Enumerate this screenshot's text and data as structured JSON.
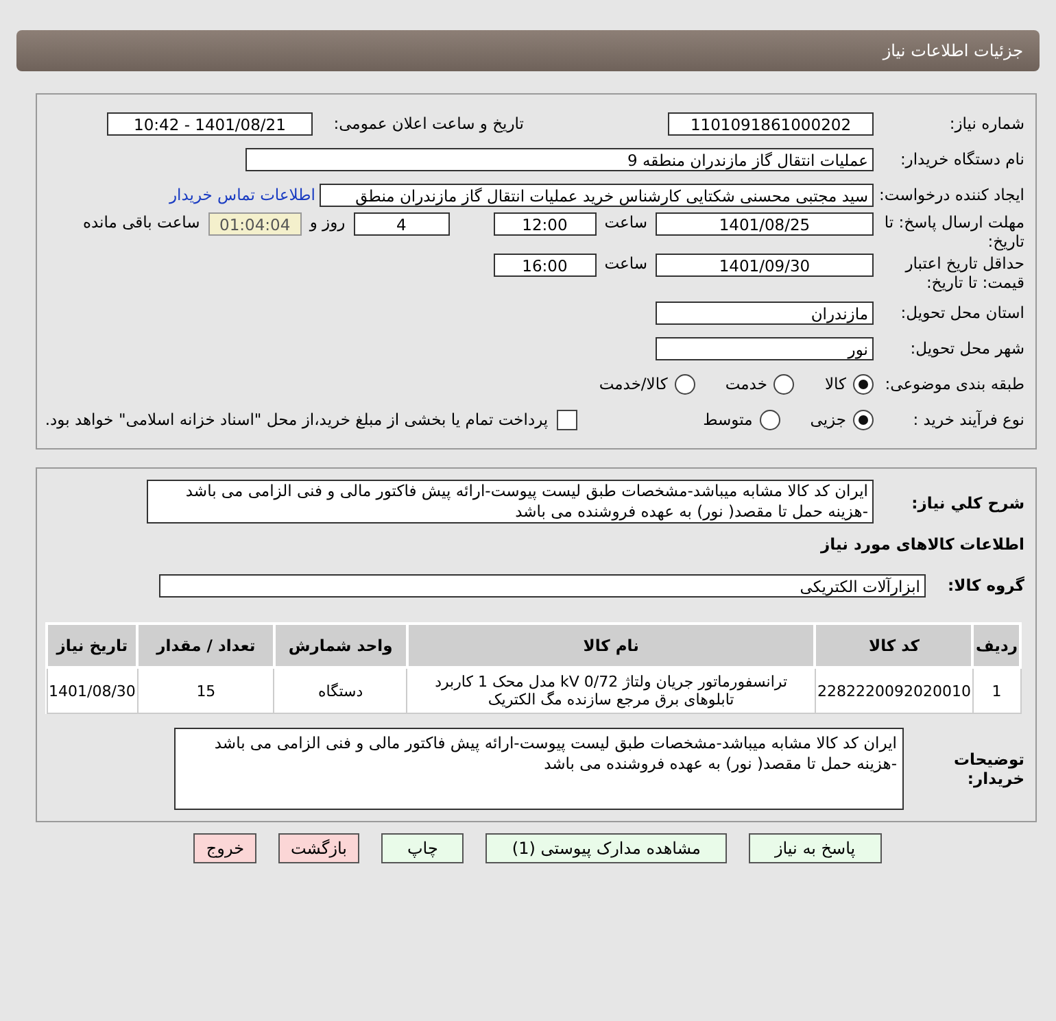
{
  "header": {
    "title": "جزئیات اطلاعات نیاز"
  },
  "need_number": {
    "label": "شماره نیاز:",
    "value": "1101091861000202"
  },
  "announce": {
    "label": "تاریخ و ساعت اعلان عمومی:",
    "value": "1401/08/21 - 10:42"
  },
  "buyer_org": {
    "label": "نام دستگاه خریدار:",
    "value": "عملیات انتقال گاز مازندران منطقه 9"
  },
  "requester": {
    "label": "ایجاد کننده درخواست:",
    "value": "سید مجتبی محسنی شکتایی کارشناس خرید عملیات انتقال گاز مازندران منطق",
    "link": "اطلاعات تماس خریدار"
  },
  "deadline": {
    "label": "مهلت ارسال پاسخ: تا تاریخ:",
    "date": "1401/08/25",
    "time_label": "ساعت",
    "time": "12:00",
    "days": "4",
    "days_label": "روز و",
    "remaining": "01:04:04",
    "remaining_label": "ساعت باقی مانده"
  },
  "validity": {
    "label": "حداقل تاریخ اعتبار قیمت: تا تاریخ:",
    "date": "1401/09/30",
    "time_label": "ساعت",
    "time": "16:00"
  },
  "province": {
    "label": "استان محل تحویل:",
    "value": "مازندران"
  },
  "city": {
    "label": "شهر محل تحویل:",
    "value": "نور"
  },
  "category": {
    "label": "طبقه بندی موضوعی:",
    "options": [
      {
        "label": "کالا",
        "selected": true
      },
      {
        "label": "خدمت",
        "selected": false
      },
      {
        "label": "کالا/خدمت",
        "selected": false
      }
    ]
  },
  "process": {
    "label": "نوع فرآیند خرید :",
    "options": [
      {
        "label": "جزیی",
        "selected": true
      },
      {
        "label": "متوسط",
        "selected": false
      }
    ],
    "treasury": {
      "label": "پرداخت تمام یا بخشی از مبلغ خرید،از محل \"اسناد خزانه اسلامی\" خواهد بود.",
      "checked": false
    }
  },
  "description": {
    "label": "شرح کلي نياز:",
    "value": "ایران کد کالا مشابه میباشد-مشخصات طبق لیست پیوست-ارائه پیش فاکتور مالی و فنی الزامی می باشد -هزینه حمل تا مقصد( نور) به عهده فروشنده می باشد"
  },
  "goods_heading": "اطلاعات کالاهای مورد نیاز",
  "goods_group": {
    "label": "گروه کالا:",
    "value": "ابزارآلات الکتریکی"
  },
  "table": {
    "columns": [
      "ردیف",
      "کد کالا",
      "نام کالا",
      "واحد شمارش",
      "تعداد / مقدار",
      "تاریخ نیاز"
    ],
    "rows": [
      [
        "1",
        "2282220092020010",
        "ترانسفورماتور جریان ولتاژ kV 0/72 مدل محک 1 کاربرد تابلوهای برق مرجع سازنده مگ الکتریک",
        "دستگاه",
        "15",
        "1401/08/30"
      ]
    ]
  },
  "buyer_notes": {
    "label": "توضیحات خریدار:",
    "value": "ایران کد کالا مشابه میباشد-مشخصات طبق لیست پیوست-ارائه پیش فاکتور مالی و فنی الزامی می باشد -هزینه حمل تا مقصد( نور) به عهده فروشنده می باشد"
  },
  "buttons": [
    {
      "label": "پاسخ به نیاز",
      "kind": "primary"
    },
    {
      "label": "مشاهده مدارک پیوستی (1)",
      "kind": "primary"
    },
    {
      "label": "چاپ",
      "kind": "primary"
    },
    {
      "label": "بازگشت",
      "kind": "danger"
    },
    {
      "label": "خروج",
      "kind": "danger"
    }
  ]
}
